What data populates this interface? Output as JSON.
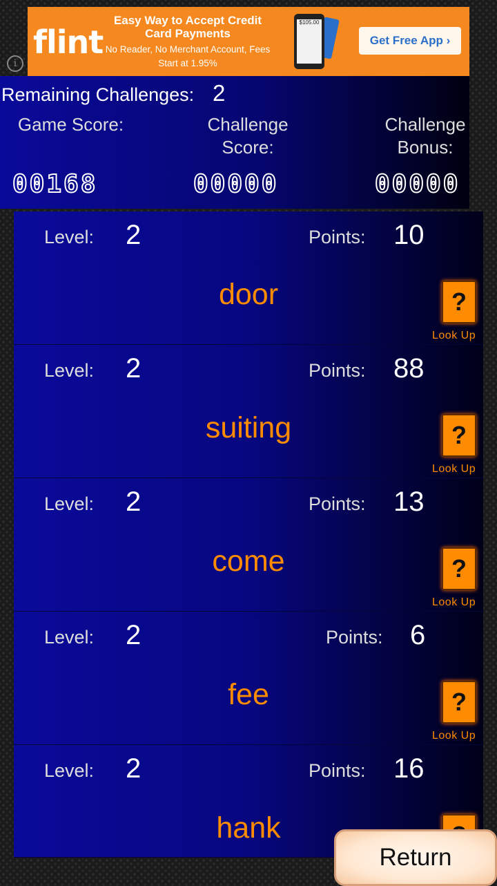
{
  "ad": {
    "logo": "flint",
    "headline": "Easy Way to Accept Credit Card Payments",
    "subtext": "No Reader, No Merchant Account, Fees Start at 1.95%",
    "phone_amount": "$105.00",
    "cta": "Get Free App ›",
    "info_icon": "i"
  },
  "header": {
    "remaining_label": "Remaining Challenges:",
    "remaining_value": "2",
    "game_score_label": "Game Score:",
    "game_score": "00168",
    "challenge_score_label": "Challenge Score:",
    "challenge_score": "00000",
    "challenge_bonus_label": "Challenge Bonus:",
    "challenge_bonus": "00000"
  },
  "rows": [
    {
      "level_label": "Level:",
      "level": "2",
      "points_label": "Points:",
      "points": "10",
      "word": "door",
      "lookup_icon": "?",
      "lookup_label": "Look Up"
    },
    {
      "level_label": "Level:",
      "level": "2",
      "points_label": "Points:",
      "points": "88",
      "word": "suiting",
      "lookup_icon": "?",
      "lookup_label": "Look Up"
    },
    {
      "level_label": "Level:",
      "level": "2",
      "points_label": "Points:",
      "points": "13",
      "word": "come",
      "lookup_icon": "?",
      "lookup_label": "Look Up"
    },
    {
      "level_label": "Level:",
      "level": "2",
      "points_label": "Points:",
      "points": "6",
      "word": "fee",
      "lookup_icon": "?",
      "lookup_label": "Look Up"
    },
    {
      "level_label": "Level:",
      "level": "2",
      "points_label": "Points:",
      "points": "16",
      "word": "hank",
      "lookup_icon": "?",
      "lookup_label": ""
    }
  ],
  "return_label": "Return"
}
